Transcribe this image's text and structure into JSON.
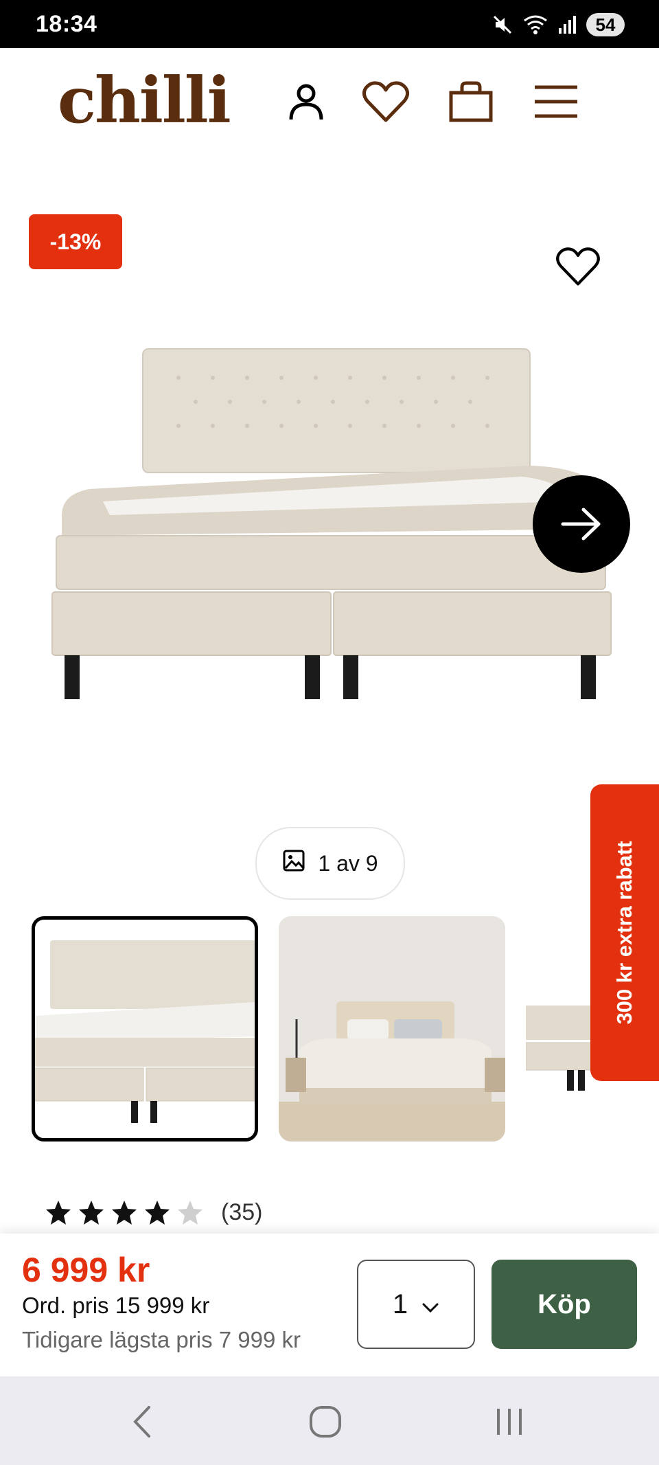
{
  "status_bar": {
    "time": "18:34",
    "battery": "54"
  },
  "header": {
    "logo": "chilli"
  },
  "product": {
    "discount_badge": "-13%",
    "image_counter": "1 av 9",
    "promo_tab": "300 kr extra rabatt",
    "rating": {
      "value": 4.5,
      "max": 5,
      "count": "(35)"
    }
  },
  "purchase": {
    "price": "6 999 kr",
    "ordinary_price": "Ord. pris 15 999 kr",
    "lowest_price": "Tidigare lägsta pris 7 999 kr",
    "quantity": "1",
    "buy_label": "Köp"
  },
  "colors": {
    "brand": "#5a2d0f",
    "accent": "#e3300f",
    "buy": "#3e6145"
  },
  "icons": [
    "user-icon",
    "heart-icon",
    "bag-icon",
    "menu-icon",
    "arrow-right-icon",
    "image-icon",
    "chevron-down-icon",
    "star-icon",
    "back-icon",
    "home-icon",
    "recents-icon"
  ]
}
